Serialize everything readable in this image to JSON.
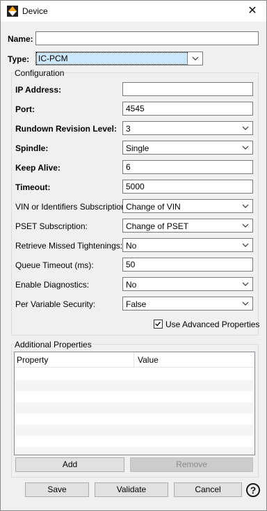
{
  "window": {
    "title": "Device"
  },
  "device": {
    "name_label": "Name:",
    "name_value": "",
    "type_label": "Type:",
    "type_value": "IC-PCM"
  },
  "configuration": {
    "group_title": "Configuration",
    "fields": {
      "ip_address": {
        "label": "IP Address:",
        "value": ""
      },
      "port": {
        "label": "Port:",
        "value": "4545"
      },
      "rundown_revision": {
        "label": "Rundown Revision Level:",
        "value": "3"
      },
      "spindle": {
        "label": "Spindle:",
        "value": "Single"
      },
      "keep_alive": {
        "label": "Keep Alive:",
        "value": "6"
      },
      "timeout": {
        "label": "Timeout:",
        "value": "5000"
      },
      "vin_subscription": {
        "label": "VIN or Identifiers Subscription:",
        "value": "Change of VIN"
      },
      "pset_subscription": {
        "label": "PSET Subscription:",
        "value": "Change of PSET"
      },
      "retrieve_missed": {
        "label": "Retrieve Missed Tightenings:",
        "value": "No"
      },
      "queue_timeout": {
        "label": "Queue Timeout (ms):",
        "value": "50"
      },
      "enable_diagnostics": {
        "label": "Enable Diagnostics:",
        "value": "No"
      },
      "per_variable_security": {
        "label": "Per Variable Security:",
        "value": "False"
      }
    },
    "advanced": {
      "label": "Use Advanced Properties",
      "checked": true
    }
  },
  "additional_properties": {
    "group_title": "Additional Properties",
    "columns": [
      "Property",
      "Value"
    ],
    "rows": [],
    "add_label": "Add",
    "remove_label": "Remove"
  },
  "footer": {
    "save_label": "Save",
    "validate_label": "Validate",
    "cancel_label": "Cancel",
    "help_label": "?"
  },
  "colors": {
    "selection": "#cce8ff",
    "button_face": "#e1e1e1",
    "disabled_face": "#cccccc",
    "row_alt": "#f5f5f5"
  }
}
